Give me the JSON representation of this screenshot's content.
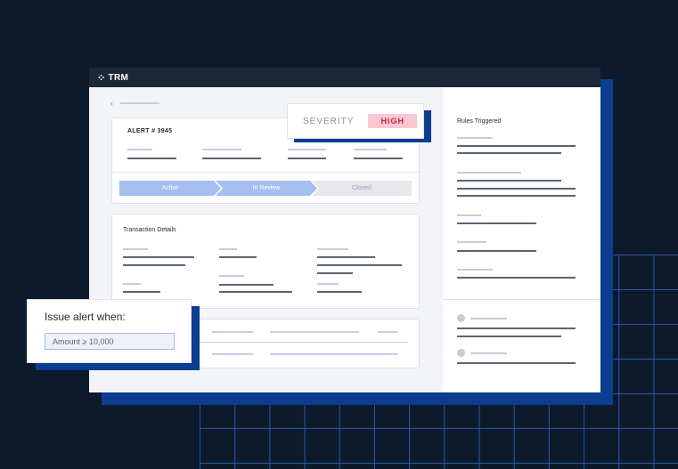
{
  "app": {
    "logo_icon": "trm-logo-icon",
    "title": "TRM"
  },
  "alert": {
    "title": "ALERT # 3945"
  },
  "status_steps": [
    {
      "label": "Active",
      "state": "done"
    },
    {
      "label": "In Review",
      "state": "current"
    },
    {
      "label": "Closed",
      "state": "pending"
    }
  ],
  "transaction": {
    "title": "Transaction Details"
  },
  "rules": {
    "title": "Rules Triggered"
  },
  "severity": {
    "label": "SEVERITY",
    "value": "HIGH",
    "badge_color": "#f9c8d3",
    "text_color": "#c7243f"
  },
  "issue_alert": {
    "label": "Issue alert when:",
    "condition": "Amount ≥ 10,000"
  },
  "colors": {
    "background": "#0c1a2b",
    "accent": "#0b3d91",
    "step_active": "#a7bef0"
  }
}
